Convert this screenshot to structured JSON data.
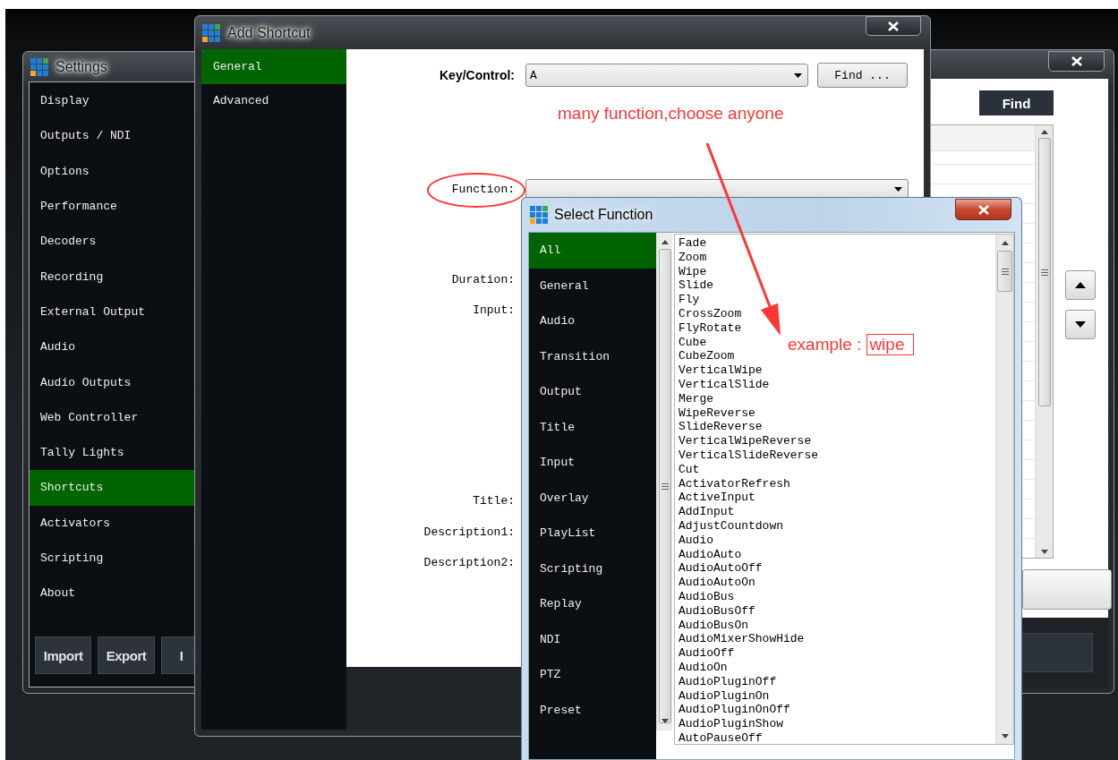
{
  "settings_window": {
    "title": "Settings",
    "menu": [
      {
        "label": "Display",
        "selected": false
      },
      {
        "label": "Outputs / NDI",
        "selected": false
      },
      {
        "label": "Options",
        "selected": false
      },
      {
        "label": "Performance",
        "selected": false
      },
      {
        "label": "Decoders",
        "selected": false
      },
      {
        "label": "Recording",
        "selected": false
      },
      {
        "label": "External Output",
        "selected": false
      },
      {
        "label": "Audio",
        "selected": false
      },
      {
        "label": "Audio Outputs",
        "selected": false
      },
      {
        "label": "Web Controller",
        "selected": false
      },
      {
        "label": "Tally Lights",
        "selected": false
      },
      {
        "label": "Shortcuts",
        "selected": true
      },
      {
        "label": "Activators",
        "selected": false
      },
      {
        "label": "Scripting",
        "selected": false
      },
      {
        "label": "About",
        "selected": false
      }
    ],
    "buttons": [
      "Import",
      "Export",
      "I"
    ]
  },
  "shortcuts_window": {
    "find_button": "Find"
  },
  "add_shortcut_window": {
    "title": "Add Shortcut",
    "tabs": [
      {
        "label": "General",
        "selected": true
      },
      {
        "label": "Advanced",
        "selected": false
      }
    ],
    "key_control_label": "Key/Control:",
    "key_control_value": "A",
    "find_button": "Find ...",
    "function_label": "Function:",
    "labels": [
      "Duration:",
      "Input:",
      "Title:",
      "Description1:",
      "Description2:"
    ]
  },
  "select_function_window": {
    "title": "Select Function",
    "categories": [
      {
        "label": "All",
        "selected": true
      },
      {
        "label": "General",
        "selected": false
      },
      {
        "label": "Audio",
        "selected": false
      },
      {
        "label": "Transition",
        "selected": false
      },
      {
        "label": "Output",
        "selected": false
      },
      {
        "label": "Title",
        "selected": false
      },
      {
        "label": "Input",
        "selected": false
      },
      {
        "label": "Overlay",
        "selected": false
      },
      {
        "label": "PlayList",
        "selected": false
      },
      {
        "label": "Scripting",
        "selected": false
      },
      {
        "label": "Replay",
        "selected": false
      },
      {
        "label": "NDI",
        "selected": false
      },
      {
        "label": "PTZ",
        "selected": false
      },
      {
        "label": "Preset",
        "selected": false
      }
    ],
    "functions": [
      {
        "label": "Fade",
        "selected": false
      },
      {
        "label": "Zoom",
        "selected": false
      },
      {
        "label": "Wipe",
        "selected": false
      },
      {
        "label": "Slide",
        "selected": false
      },
      {
        "label": "Fly",
        "selected": false
      },
      {
        "label": "CrossZoom",
        "selected": false
      },
      {
        "label": "FlyRotate",
        "selected": false
      },
      {
        "label": "Cube",
        "selected": false
      },
      {
        "label": "CubeZoom",
        "selected": false
      },
      {
        "label": "VerticalWipe",
        "selected": false
      },
      {
        "label": "VerticalSlide",
        "selected": false
      },
      {
        "label": "Merge",
        "selected": false
      },
      {
        "label": "WipeReverse",
        "selected": false
      },
      {
        "label": "SlideReverse",
        "selected": false
      },
      {
        "label": "VerticalWipeReverse",
        "selected": false
      },
      {
        "label": "VerticalSlideReverse",
        "selected": false
      },
      {
        "label": "Cut",
        "selected": false
      },
      {
        "label": "ActivatorRefresh",
        "selected": false
      },
      {
        "label": "ActiveInput",
        "selected": false
      },
      {
        "label": "AddInput",
        "selected": false
      },
      {
        "label": "AdjustCountdown",
        "selected": false
      },
      {
        "label": "Audio",
        "selected": false
      },
      {
        "label": "AudioAuto",
        "selected": false
      },
      {
        "label": "AudioAutoOff",
        "selected": false
      },
      {
        "label": "AudioAutoOn",
        "selected": false
      },
      {
        "label": "AudioBus",
        "selected": false
      },
      {
        "label": "AudioBusOff",
        "selected": false
      },
      {
        "label": "AudioBusOn",
        "selected": false
      },
      {
        "label": "AudioMixerShowHide",
        "selected": false
      },
      {
        "label": "AudioOff",
        "selected": false
      },
      {
        "label": "AudioOn",
        "selected": false
      },
      {
        "label": "AudioPluginOff",
        "selected": false
      },
      {
        "label": "AudioPluginOn",
        "selected": false
      },
      {
        "label": "AudioPluginOnOff",
        "selected": false
      },
      {
        "label": "AudioPluginShow",
        "selected": false
      },
      {
        "label": "AutoPauseOff",
        "selected": false
      }
    ]
  },
  "annotations": {
    "hint": "many function,choose anyone",
    "example_label": "example :",
    "example_value": "wipe"
  }
}
